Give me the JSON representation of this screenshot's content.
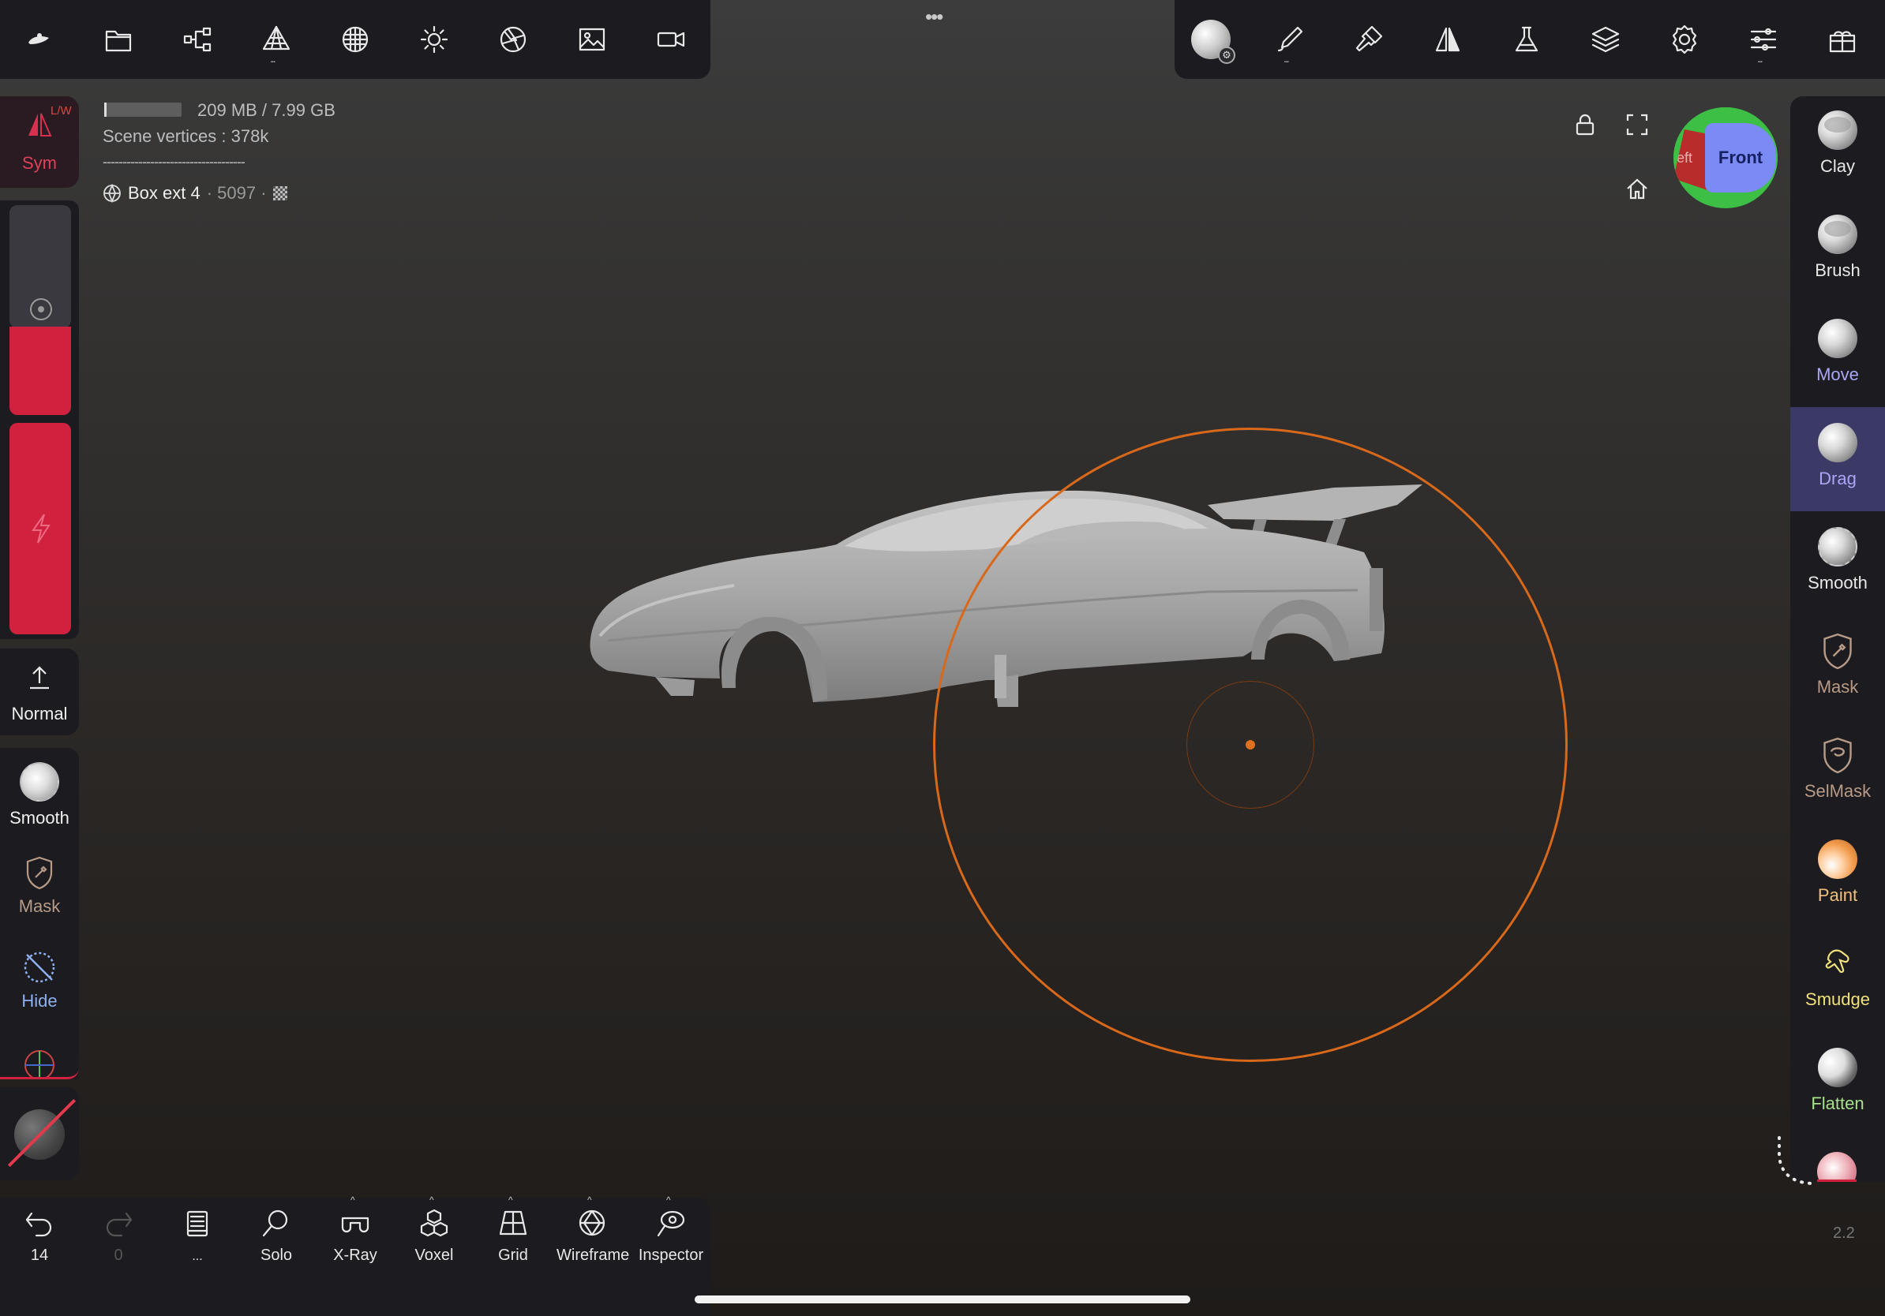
{
  "top_toolbar": {
    "icons": [
      "nomad-logo-icon",
      "files-icon",
      "scene-graph-icon",
      "mesh-topology-icon",
      "material-sphere-icon",
      "light-icon",
      "camera-aperture-icon",
      "background-image-icon",
      "video-icon"
    ],
    "more_dots": "•••"
  },
  "right_toolbar": {
    "icons": [
      "material-icon",
      "brush-stroke-icon",
      "painting-icon",
      "symmetry-icon",
      "flask-icon",
      "layers-icon",
      "settings-icon",
      "sliders-icon",
      "gift-icon"
    ]
  },
  "info": {
    "memory": "209 MB / 7.99 GB",
    "vertices": "Scene vertices :  378k",
    "separator": "------------------------------------",
    "object_name": "Box ext 4",
    "object_vertices": "· 5097 ·"
  },
  "left_panel": {
    "sym_label": "Sym",
    "sym_tag": "L/W",
    "normal_label": "Normal",
    "smooth_label": "Smooth",
    "mask_label": "Mask",
    "hide_label": "Hide"
  },
  "right_tools": [
    {
      "label": "Clay",
      "color": "#e8e8e8"
    },
    {
      "label": "Brush",
      "color": "#e8e8e8"
    },
    {
      "label": "Move",
      "color": "#a9a7f5"
    },
    {
      "label": "Drag",
      "color": "#a9a7f5",
      "selected": true
    },
    {
      "label": "Smooth",
      "color": "#e8e8e8"
    },
    {
      "label": "Mask",
      "color": "#b79b86"
    },
    {
      "label": "SelMask",
      "color": "#b79b86"
    },
    {
      "label": "Paint",
      "color": "#f0c07a"
    },
    {
      "label": "Smudge",
      "color": "#f0e07a"
    },
    {
      "label": "Flatten",
      "color": "#a6e08a"
    }
  ],
  "view_cube": {
    "front_label": "Front",
    "left_label": "eft"
  },
  "bottom_toolbar": {
    "undo_count": "14",
    "redo_count": "0",
    "history_label": "...",
    "solo_label": "Solo",
    "xray_label": "X-Ray",
    "voxel_label": "Voxel",
    "grid_label": "Grid",
    "wireframe_label": "Wireframe",
    "inspector_label": "Inspector"
  },
  "version": "2.2"
}
